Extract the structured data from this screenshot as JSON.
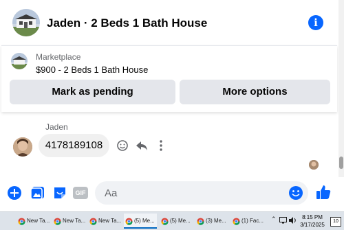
{
  "header": {
    "title": "Jaden · 2 Beds 1 Bath House",
    "info_glyph": "i",
    "avatar_icon": "house-photo"
  },
  "listing": {
    "label": "Marketplace",
    "title": "$900 - 2 Beds 1 Bath House",
    "thumb_icon": "house-photo"
  },
  "actions": {
    "mark_pending": "Mark as pending",
    "more_options": "More options"
  },
  "conversation": {
    "sender": "Jaden",
    "message": "4178189108"
  },
  "composer": {
    "placeholder": "Aa",
    "gif_label": "GIF"
  },
  "taskbar": {
    "tasks": [
      {
        "label": "New Ta..."
      },
      {
        "label": "New Ta..."
      },
      {
        "label": "New Ta..."
      },
      {
        "label": "(5) Me..."
      },
      {
        "label": "(5) Me..."
      },
      {
        "label": "(3) Me..."
      },
      {
        "label": "(1) Fac..."
      }
    ],
    "time": "8:15 PM",
    "date": "3/17/2025",
    "notification_count": "10"
  },
  "colors": {
    "accent": "#0866ff",
    "button_bg": "#e4e6eb",
    "bubble_bg": "#f0f0f0"
  }
}
